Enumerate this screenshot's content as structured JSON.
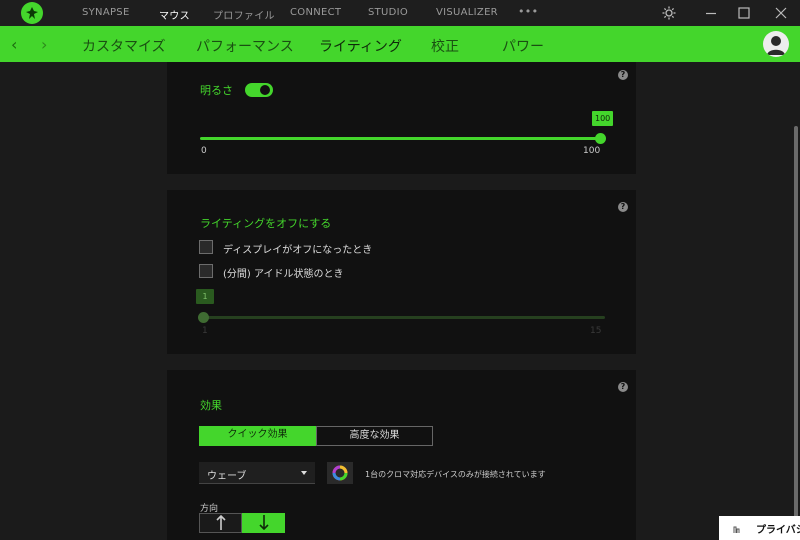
{
  "titlebar": {
    "nav": [
      "SYNAPSE",
      "マウス",
      "プロファイル",
      "CONNECT",
      "STUDIO",
      "VISUALIZER"
    ],
    "more": "•••"
  },
  "tabbar": {
    "back": "‹",
    "forward": "›",
    "tabs": [
      "カスタマイズ",
      "パフォーマンス",
      "ライティング",
      "校正",
      "パワー"
    ]
  },
  "brightness": {
    "label": "明るさ",
    "toggle_on": true,
    "value": 100,
    "tip": "100",
    "min": "0",
    "max": "100",
    "help": "?"
  },
  "lighting_off": {
    "title": "ライティングをオフにする",
    "options": [
      "ディスプレイがオフになったとき",
      "(分間) アイドル状態のとき"
    ],
    "value": 1,
    "tip": "1",
    "min": "1",
    "max": "15",
    "help": "?"
  },
  "effects": {
    "title": "効果",
    "modes": [
      "クイック効果",
      "高度な効果"
    ],
    "selected_effect": "ウェーブ",
    "note": "1台のクロマ対応デバイスのみが接続されています",
    "direction_label": "方向",
    "help": "?"
  },
  "privacy": {
    "label": "プライバシ"
  },
  "colors": {
    "accent": "#44d62c",
    "card_bg": "#111111",
    "bg": "#1b1b1b"
  }
}
